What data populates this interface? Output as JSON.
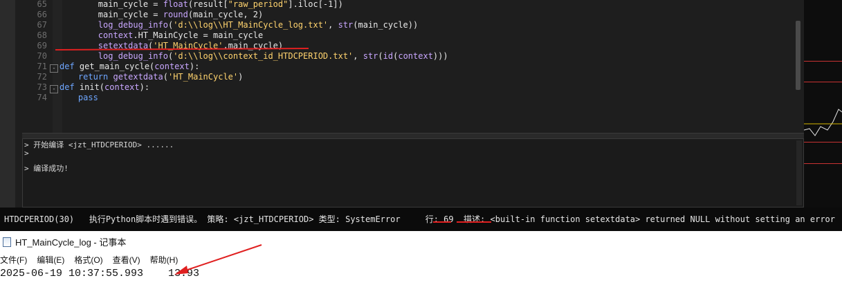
{
  "editor": {
    "lines": [
      {
        "num": "65",
        "fold": "",
        "parts": [
          {
            "t": "        main_cycle = ",
            "c": "id"
          },
          {
            "t": "float",
            "c": "fn"
          },
          {
            "t": "(result[",
            "c": "id"
          },
          {
            "t": "\"raw_period\"",
            "c": "str"
          },
          {
            "t": "].iloc[-1])",
            "c": "id"
          }
        ]
      },
      {
        "num": "66",
        "fold": "",
        "parts": [
          {
            "t": "        main_cycle = ",
            "c": "id"
          },
          {
            "t": "round",
            "c": "fn"
          },
          {
            "t": "(main_cycle, 2)",
            "c": "id"
          }
        ]
      },
      {
        "num": "67",
        "fold": "",
        "parts": [
          {
            "t": "        log_debug_info",
            "c": "fn"
          },
          {
            "t": "(",
            "c": "id"
          },
          {
            "t": "'d:\\\\log\\\\HT_MainCycle_log.txt'",
            "c": "str"
          },
          {
            "t": ", ",
            "c": "id"
          },
          {
            "t": "str",
            "c": "fn"
          },
          {
            "t": "(main_cycle))",
            "c": "id"
          }
        ]
      },
      {
        "num": "68",
        "fold": "",
        "parts": [
          {
            "t": "        context",
            "c": "fn"
          },
          {
            "t": ".HT_MainCycle = main_cycle",
            "c": "id"
          }
        ]
      },
      {
        "num": "69",
        "fold": "",
        "parts": [
          {
            "t": "        setextdata",
            "c": "fn"
          },
          {
            "t": "(",
            "c": "id"
          },
          {
            "t": "'HT_MainCycle'",
            "c": "str"
          },
          {
            "t": ",main_cycle)",
            "c": "id"
          }
        ]
      },
      {
        "num": "70",
        "fold": "",
        "parts": [
          {
            "t": "        log_debug_info",
            "c": "fn"
          },
          {
            "t": "(",
            "c": "id"
          },
          {
            "t": "'d:\\\\log\\\\context_id_HTDCPERIOD.txt'",
            "c": "str"
          },
          {
            "t": ", ",
            "c": "id"
          },
          {
            "t": "str",
            "c": "fn"
          },
          {
            "t": "(",
            "c": "id"
          },
          {
            "t": "id",
            "c": "fn"
          },
          {
            "t": "(",
            "c": "id"
          },
          {
            "t": "context",
            "c": "fn"
          },
          {
            "t": ")))",
            "c": "id"
          }
        ]
      },
      {
        "num": "71",
        "fold": "-",
        "parts": [
          {
            "t": "def ",
            "c": "kw"
          },
          {
            "t": "get_main_cycle(",
            "c": "id"
          },
          {
            "t": "context",
            "c": "fn"
          },
          {
            "t": "):",
            "c": "id"
          }
        ]
      },
      {
        "num": "72",
        "fold": "",
        "parts": [
          {
            "t": "    return ",
            "c": "kw"
          },
          {
            "t": "getextdata",
            "c": "fn"
          },
          {
            "t": "(",
            "c": "id"
          },
          {
            "t": "'HT_MainCycle'",
            "c": "str"
          },
          {
            "t": ")",
            "c": "id"
          }
        ]
      },
      {
        "num": "73",
        "fold": "-",
        "parts": [
          {
            "t": "def ",
            "c": "kw"
          },
          {
            "t": "init(",
            "c": "id"
          },
          {
            "t": "context",
            "c": "fn"
          },
          {
            "t": "):",
            "c": "id"
          }
        ]
      },
      {
        "num": "74",
        "fold": "",
        "parts": [
          {
            "t": "    pass",
            "c": "kw"
          }
        ]
      }
    ]
  },
  "output": {
    "line1": "> 开始编译 <jzt_HTDCPERIOD> ......",
    "line2": ">",
    "line3": "> 编译成功!"
  },
  "status": {
    "text": "HTDCPERIOD(30)   执行Python脚本时遇到错误。 策略: <jzt_HTDCPERIOD> 类型: SystemError     行: 69  描述: <built-in function setextdata> returned NULL without setting an error"
  },
  "notepad": {
    "title": "HT_MainCycle_log - 记事本",
    "menu": [
      "文件(F)",
      "编辑(E)",
      "格式(O)",
      "查看(V)",
      "帮助(H)"
    ],
    "content": "2025-06-19 10:37:55.993    13.93"
  },
  "colors": {
    "annotation": "#e02020",
    "keyword": "#6ea6ff",
    "string": "#ffd36e",
    "function": "#c9a7ff"
  }
}
